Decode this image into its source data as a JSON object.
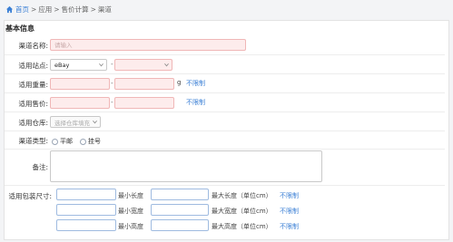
{
  "breadcrumb": {
    "home": "首页",
    "sep1": ">",
    "app": "应用",
    "sep2": ">",
    "pricing": "售价计算",
    "sep3": ">",
    "channel": "渠道"
  },
  "section_title": "基本信息",
  "fields": {
    "channel_name": {
      "label": "渠道名称:",
      "placeholder": "请输入"
    },
    "site": {
      "label": "适用站点:",
      "value": "eBay",
      "dash": "-"
    },
    "weight": {
      "label": "适用重量:",
      "dash": "-",
      "unit": "g",
      "link": "不限制"
    },
    "price": {
      "label": "适用售价:",
      "dash": "-",
      "link": "不限制"
    },
    "warehouse": {
      "label": "适用仓库:",
      "placeholder": "选择仓库填充"
    },
    "channel_type": {
      "label": "渠道类型:",
      "options": [
        "平邮",
        "挂号"
      ]
    },
    "remark": {
      "label": "备注:"
    },
    "package_size": {
      "label": "适用包装尺寸:",
      "rows": [
        {
          "min_label": "最小长度",
          "max_label": "最大长度（单位cm）",
          "link": "不限制"
        },
        {
          "min_label": "最小宽度",
          "max_label": "最大宽度（单位cm）",
          "link": "不限制"
        },
        {
          "min_label": "最小高度",
          "max_label": "最大高度（单位cm）",
          "link": "不限制"
        }
      ]
    }
  }
}
